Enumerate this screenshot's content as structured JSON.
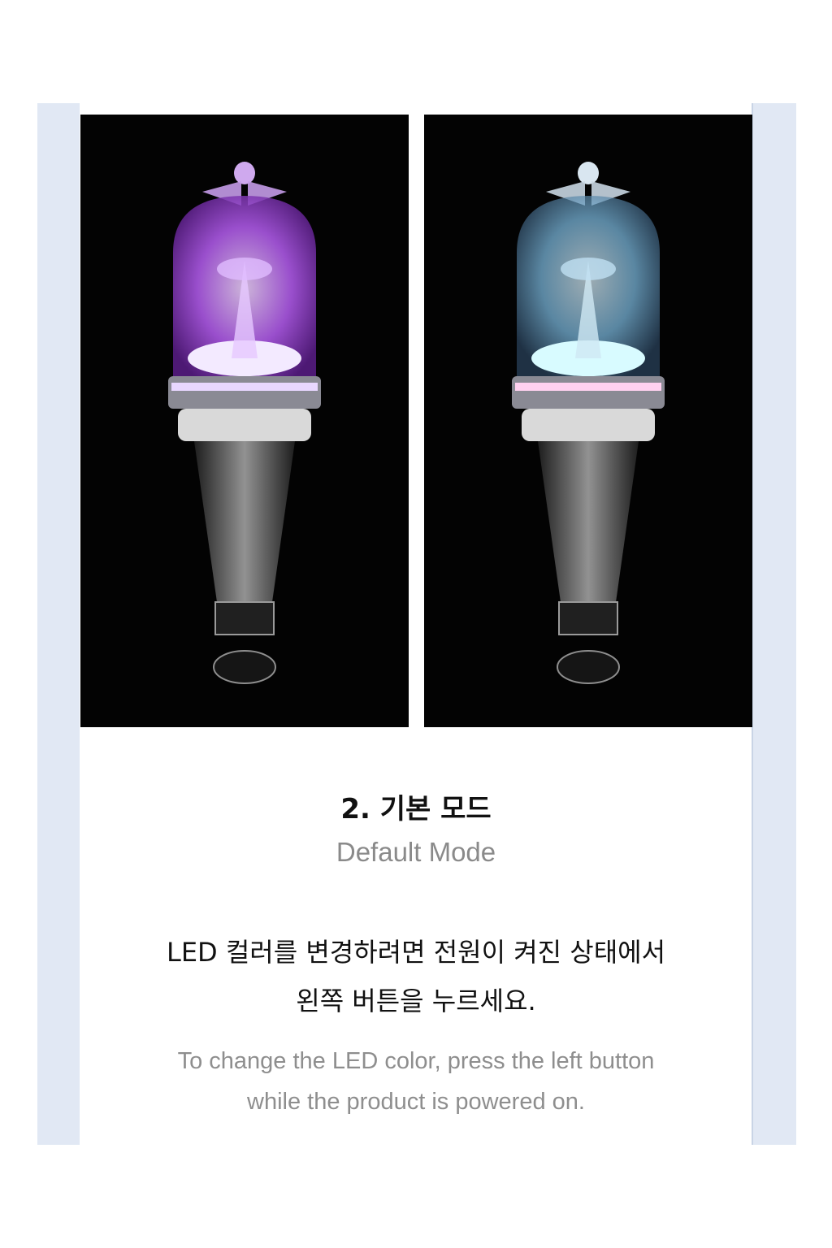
{
  "photos": [
    {
      "label": "purple-glow",
      "glow_color": "#b45cf0",
      "accent_color": "#d9a6ff"
    },
    {
      "label": "multicolor-glow",
      "glow_color": "#5ecbff",
      "accent_color": "#9fe8ff"
    }
  ],
  "heading": "2. 기본 모드",
  "subheading": "Default Mode",
  "korean_text": [
    "LED 컬러를 변경하려면 전원이 켜진 상태에서",
    "왼쪽 버튼을 누르세요."
  ],
  "english_text": [
    "To change the LED color, press the left button",
    "while the product is powered on."
  ],
  "colors": {
    "sidebar": "#e1e8f4",
    "photo_bg": "#030303"
  }
}
